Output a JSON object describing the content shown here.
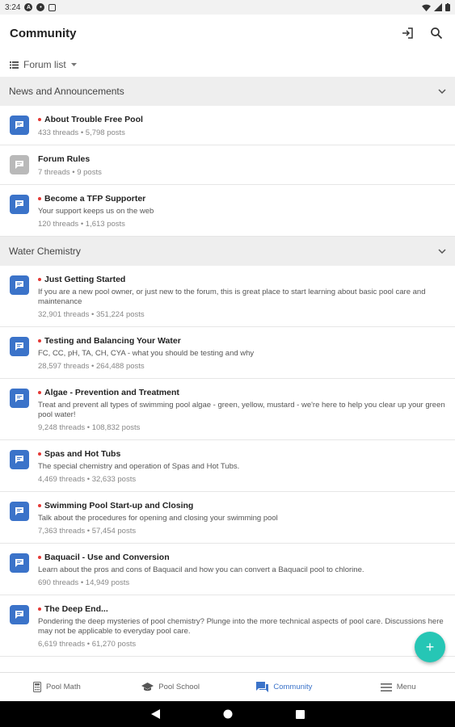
{
  "status_bar": {
    "time": "3:24"
  },
  "app_bar": {
    "title": "Community"
  },
  "forum_selector": {
    "label": "Forum list"
  },
  "sections": [
    {
      "title": "News and Announcements",
      "forums": [
        {
          "title": "About Trouble Free Pool",
          "desc": "",
          "stats": "433 threads • 5,798 posts",
          "unread": true
        },
        {
          "title": "Forum Rules",
          "desc": "",
          "stats": "7 threads • 9 posts",
          "unread": false
        },
        {
          "title": "Become a TFP Supporter",
          "desc": "Your support keeps us on the web",
          "stats": "120 threads • 1,613 posts",
          "unread": true
        }
      ]
    },
    {
      "title": "Water Chemistry",
      "forums": [
        {
          "title": "Just Getting Started",
          "desc": "If you are a new pool owner, or just new to the forum, this is great place to start learning about basic pool care and maintenance",
          "stats": "32,901 threads • 351,224 posts",
          "unread": true
        },
        {
          "title": "Testing and Balancing Your Water",
          "desc": "FC, CC, pH, TA, CH, CYA - what you should be testing and why",
          "stats": "28,597 threads • 264,488 posts",
          "unread": true
        },
        {
          "title": "Algae  - Prevention and Treatment",
          "desc": "Treat and prevent all types of swimming pool algae - green, yellow, mustard - we're here to help you clear up your green pool water!",
          "stats": "9,248 threads • 108,832 posts",
          "unread": true
        },
        {
          "title": "Spas and Hot Tubs",
          "desc": "The special chemistry and operation of Spas and Hot Tubs.",
          "stats": "4,469 threads • 32,633 posts",
          "unread": true
        },
        {
          "title": "Swimming Pool Start-up and Closing",
          "desc": "Talk about the procedures for opening and closing your swimming pool",
          "stats": "7,363 threads • 57,454 posts",
          "unread": true
        },
        {
          "title": "Baquacil - Use and Conversion",
          "desc": "Learn about the pros and cons of Baquacil and how you can convert a Baquacil pool to chlorine.",
          "stats": "690 threads • 14,949 posts",
          "unread": true
        },
        {
          "title": "The Deep End...",
          "desc": "Pondering the deep mysteries of pool chemistry? Plunge into the more technical aspects of pool care. Discussions here may not be applicable to everyday pool care.",
          "stats": "6,619 threads • 61,270 posts",
          "unread": true
        }
      ]
    }
  ],
  "bottom_nav": [
    {
      "label": "Pool Math",
      "icon": "calculator-icon",
      "active": false
    },
    {
      "label": "Pool School",
      "icon": "school-icon",
      "active": false
    },
    {
      "label": "Community",
      "icon": "forum-icon",
      "active": true
    },
    {
      "label": "Menu",
      "icon": "menu-icon",
      "active": false
    }
  ],
  "colors": {
    "accent": "#3b73c9",
    "fab": "#26c6b5",
    "unread_dot": "#e53935"
  }
}
